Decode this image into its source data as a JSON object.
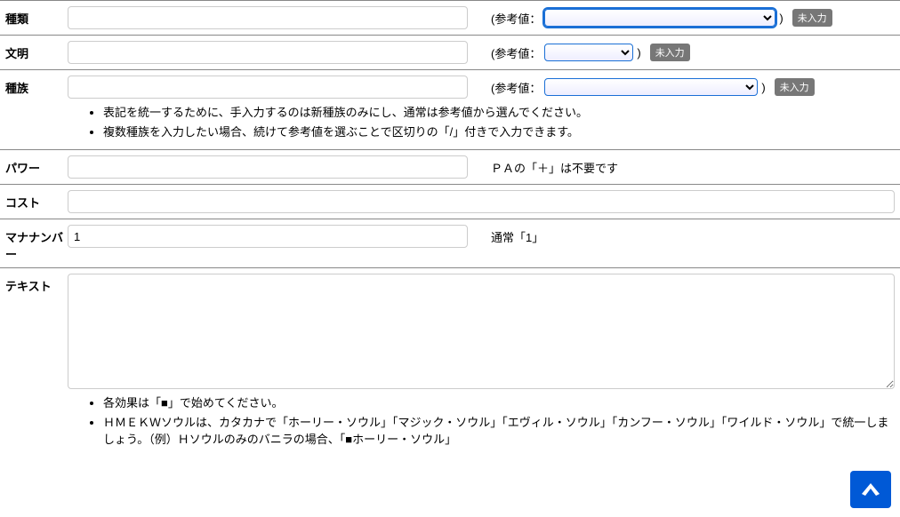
{
  "labels": {
    "type": "種類",
    "civ": "文明",
    "race": "種族",
    "power": "パワー",
    "cost": "コスト",
    "mana": "マナナンバー",
    "text": "テキスト",
    "refPrefix": "(参考値：",
    "refSuffix": ")",
    "badgeEmpty": "未入力"
  },
  "values": {
    "type": "",
    "civ": "",
    "race": "",
    "power": "",
    "cost": "",
    "mana": "1",
    "text": ""
  },
  "notes": {
    "race1": "表記を統一するために、手入力するのは新種族のみにし、通常は参考値から選んでください。",
    "race2": "複数種族を入力したい場合、続けて参考値を選ぶことで区切りの「/」付きで入力できます。",
    "power": "ＰＡの「＋」は不要です",
    "mana": "通常「1」",
    "text1": "各効果は「■」で始めてください。",
    "text2": "ＨＭＥＫＷソウルは、カタカナで「ホーリー・ソウル」「マジック・ソウル」「エヴィル・ソウル」「カンフー・ソウル」「ワイルド・ソウル」で統一しましょう。（例）Ｈソウルのみのバニラの場合、「■ホーリー・ソウル」"
  }
}
